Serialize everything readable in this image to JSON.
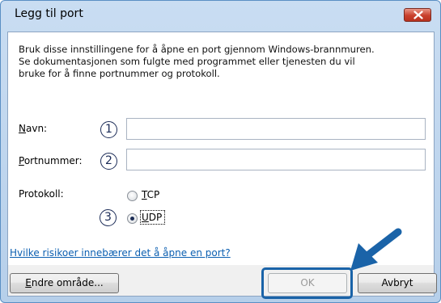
{
  "window": {
    "title": "Legg til port"
  },
  "description": {
    "lines": [
      "Bruk disse innstillingene for å åpne en port gjennom Windows-brannmuren.",
      "Se dokumentasjonen som fulgte med programmet eller tjenesten du vil",
      "bruke for å finne portnummer og protokoll."
    ]
  },
  "fields": {
    "name": {
      "label_key": "N",
      "label_rest": "avn:",
      "value": "",
      "step": "1"
    },
    "port": {
      "label_key": "P",
      "label_rest": "ortnummer:",
      "value": "",
      "step": "2"
    }
  },
  "protocol": {
    "label": "Protokoll:",
    "step": "3",
    "options": [
      {
        "key": "T",
        "rest": "CP",
        "selected": false
      },
      {
        "key": "U",
        "rest": "DP",
        "selected": true
      }
    ]
  },
  "link": {
    "text": "Hvilke risikoer innebærer det å åpne en port?"
  },
  "buttons": {
    "change_scope": {
      "key": "E",
      "rest": "ndre område..."
    },
    "ok": "OK",
    "cancel": "Avbryt"
  },
  "colors": {
    "annotation_arrow": "#1a63a8",
    "link": "#0b5fb1"
  }
}
